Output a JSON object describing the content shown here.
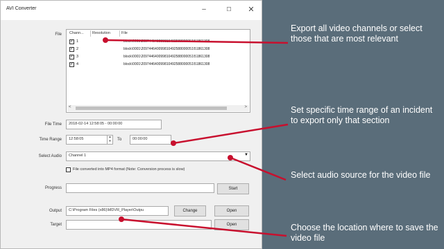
{
  "window": {
    "title": "AVI Converter",
    "minimize": "–",
    "maximize": "☐",
    "close": "✕"
  },
  "file": {
    "label": "File",
    "columns": [
      "Chann...",
      "Resolution",
      "File"
    ],
    "rows": [
      {
        "channel": "1",
        "checked": true,
        "file": "block\\0001\\209744640099810492588000051\\51861308"
      },
      {
        "channel": "2",
        "checked": true,
        "file": "block\\0001\\209744640099810492588000051\\51861308"
      },
      {
        "channel": "3",
        "checked": true,
        "file": "block\\0001\\209744640099810492588000051\\51861308"
      },
      {
        "channel": "4",
        "checked": true,
        "file": "block\\0001\\209744640099810492588000051\\51861308"
      }
    ],
    "scroll_left": "<",
    "scroll_right": ">"
  },
  "file_time": {
    "label": "File Time",
    "value": "2018-02-14 12:58:05 - 00:00:00"
  },
  "time_range": {
    "label": "Time Range",
    "from": "12:58:05",
    "to_label": "To",
    "to": "00:00:00"
  },
  "select_audio": {
    "label": "Select Audio",
    "value": "Channel 1"
  },
  "mp4_option": {
    "checked": false,
    "label": "File converted into MP4 format (Note: Conversion process is slow)"
  },
  "progress": {
    "label": "Progress",
    "start_button": "Start"
  },
  "output": {
    "label": "Output",
    "value": "C:\\Program Files (x86)\\MDVR_Player\\Outpu",
    "change_button": "Change",
    "open_button": "Open"
  },
  "target": {
    "label": "Target",
    "value": "",
    "open_button": "Open"
  },
  "annotations": {
    "export_channels": "Export all video channels or select those that are most relevant",
    "time_range": "Set specific time range of an incident to export only that section",
    "audio_source": "Select audio source for the video file",
    "save_location": "Choose the location where to save the video file"
  },
  "colors": {
    "background": "#5a6d7a",
    "arrow": "#c8102e",
    "annotation_text": "#ffffff"
  }
}
